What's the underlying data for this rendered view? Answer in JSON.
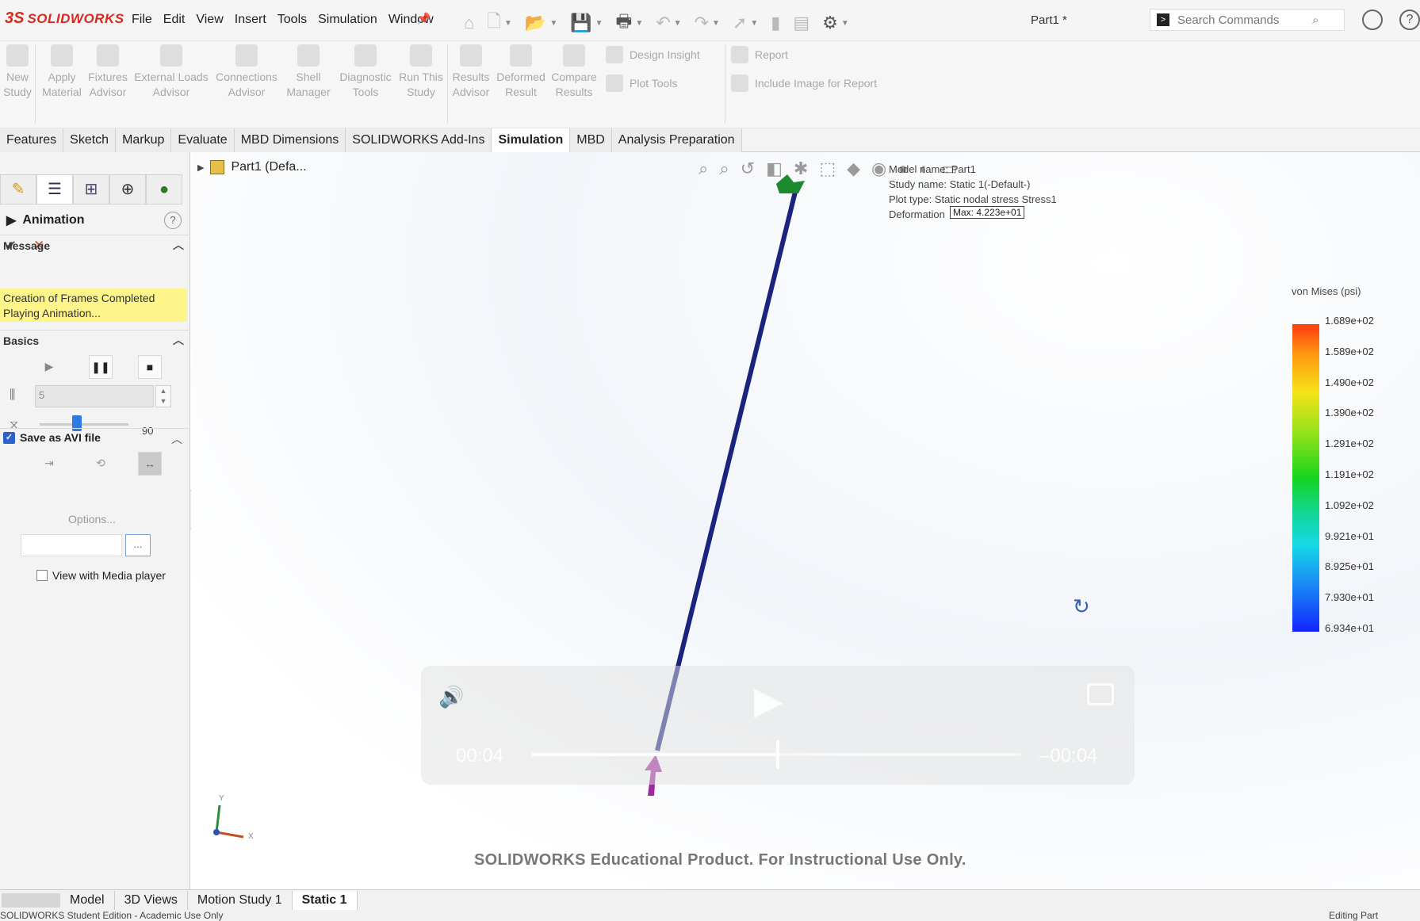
{
  "app": {
    "logo": "SOLIDWORKS",
    "menu": [
      "File",
      "Edit",
      "View",
      "Insert",
      "Tools",
      "Simulation",
      "Window"
    ],
    "doc_title": "Part1 *",
    "search_placeholder": "Search Commands"
  },
  "ribbon": {
    "buttons": [
      {
        "line1": "New",
        "line2": "Study"
      },
      {
        "line1": "Apply",
        "line2": "Material"
      },
      {
        "line1": "Fixtures",
        "line2": "Advisor"
      },
      {
        "line1": "External Loads",
        "line2": "Advisor"
      },
      {
        "line1": "Connections",
        "line2": "Advisor"
      },
      {
        "line1": "Shell",
        "line2": "Manager"
      },
      {
        "line1": "Diagnostic",
        "line2": "Tools"
      },
      {
        "line1": "Run This",
        "line2": "Study"
      },
      {
        "line1": "Results",
        "line2": "Advisor"
      },
      {
        "line1": "Deformed",
        "line2": "Result"
      },
      {
        "line1": "Compare",
        "line2": "Results"
      }
    ],
    "design_insight": "Design Insight",
    "plot_tools": "Plot Tools",
    "report": "Report",
    "include_image": "Include Image for Report"
  },
  "tabs": [
    "Features",
    "Sketch",
    "Markup",
    "Evaluate",
    "MBD Dimensions",
    "SOLIDWORKS Add-Ins",
    "Simulation",
    "MBD",
    "Analysis Preparation"
  ],
  "active_tab": "Simulation",
  "panel": {
    "title": "Animation",
    "message_header": "Message",
    "message_line1": "Creation of Frames Completed",
    "message_line2": "Playing Animation...",
    "basics_header": "Basics",
    "frames_value": "5",
    "speed_value": "90",
    "speed_fraction": 0.42,
    "save_avi_label": "Save as AVI file",
    "save_avi_checked": true,
    "options_label": "Options...",
    "browse_label": "...",
    "media_player_label": "View with Media player",
    "media_player_checked": false
  },
  "viewport": {
    "tree_label": "Part1 (Defa...",
    "plot_info": {
      "model_name": "Model name: Part1",
      "study_name": "Study name: Static 1(-Default-)",
      "plot_type": "Plot type: Static nodal stress Stress1",
      "deformation": "Deformation"
    },
    "max_label": "Max: 4.223e+01",
    "legend_title": "von Mises (psi)",
    "legend_values": [
      "1.689e+02",
      "1.589e+02",
      "1.490e+02",
      "1.390e+02",
      "1.291e+02",
      "1.191e+02",
      "1.092e+02",
      "9.921e+01",
      "8.925e+01",
      "7.930e+01",
      "6.934e+01"
    ],
    "video": {
      "elapsed": "00:04",
      "remaining": "–00:04",
      "progress": 0.5
    },
    "watermark": "SOLIDWORKS Educational Product. For Instructional Use Only.",
    "triad_y": "Y",
    "triad_x": "X"
  },
  "bottom_tabs": [
    "Model",
    "3D Views",
    "Motion Study 1",
    "Static 1"
  ],
  "active_bottom_tab": "Static 1",
  "status": {
    "left": "SOLIDWORKS Student Edition - Academic Use Only",
    "right": "Editing Part"
  },
  "colors": {
    "brand": "#d52b1e",
    "beam": "#1a237e",
    "message_bg": "#fdf58a"
  }
}
